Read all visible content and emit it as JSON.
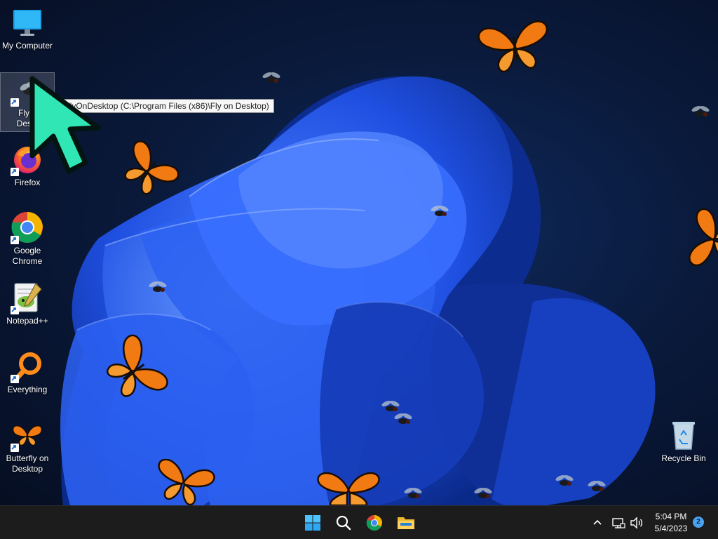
{
  "desktop": {
    "icons": [
      {
        "label": "My Computer",
        "icon": "monitor-icon",
        "shortcut": false
      },
      {
        "label": "Fly on Desktop",
        "label_visible": "Fly o\nDeskt",
        "icon": "fly-icon",
        "shortcut": true,
        "selected": true
      },
      {
        "label": "Firefox",
        "icon": "firefox-icon",
        "shortcut": true
      },
      {
        "label": "Google Chrome",
        "icon": "chrome-icon",
        "shortcut": true
      },
      {
        "label": "Notepad++",
        "icon": "notepadpp-icon",
        "shortcut": true
      },
      {
        "label": "Everything",
        "icon": "magnifier-icon",
        "shortcut": true
      },
      {
        "label": "Butterfly on Desktop",
        "icon": "butterfly-icon",
        "shortcut": true
      },
      {
        "label": "Recycle Bin",
        "icon": "recycle-bin-icon",
        "shortcut": false
      }
    ],
    "tooltip": "n: FlyOnDesktop (C:\\Program Files (x86)\\Fly on Desktop)"
  },
  "taskbar": {
    "apps": [
      {
        "name": "Start",
        "icon": "windows-start-icon"
      },
      {
        "name": "Search",
        "icon": "search-icon"
      },
      {
        "name": "Google Chrome",
        "icon": "chrome-icon"
      },
      {
        "name": "File Explorer",
        "icon": "folder-icon"
      }
    ],
    "tray": {
      "icons": [
        "chevron-up-icon",
        "network-icon",
        "volume-icon"
      ],
      "time": "5:04 PM",
      "date": "5/4/2023",
      "notification_count": "2"
    }
  },
  "colors": {
    "wallpaper_bloom": "#1f4fe0",
    "taskbar": "#1c1c1c",
    "accent": "#4aa3f0",
    "cursor": "#2fe6b4",
    "butterfly": "#f27a12"
  }
}
